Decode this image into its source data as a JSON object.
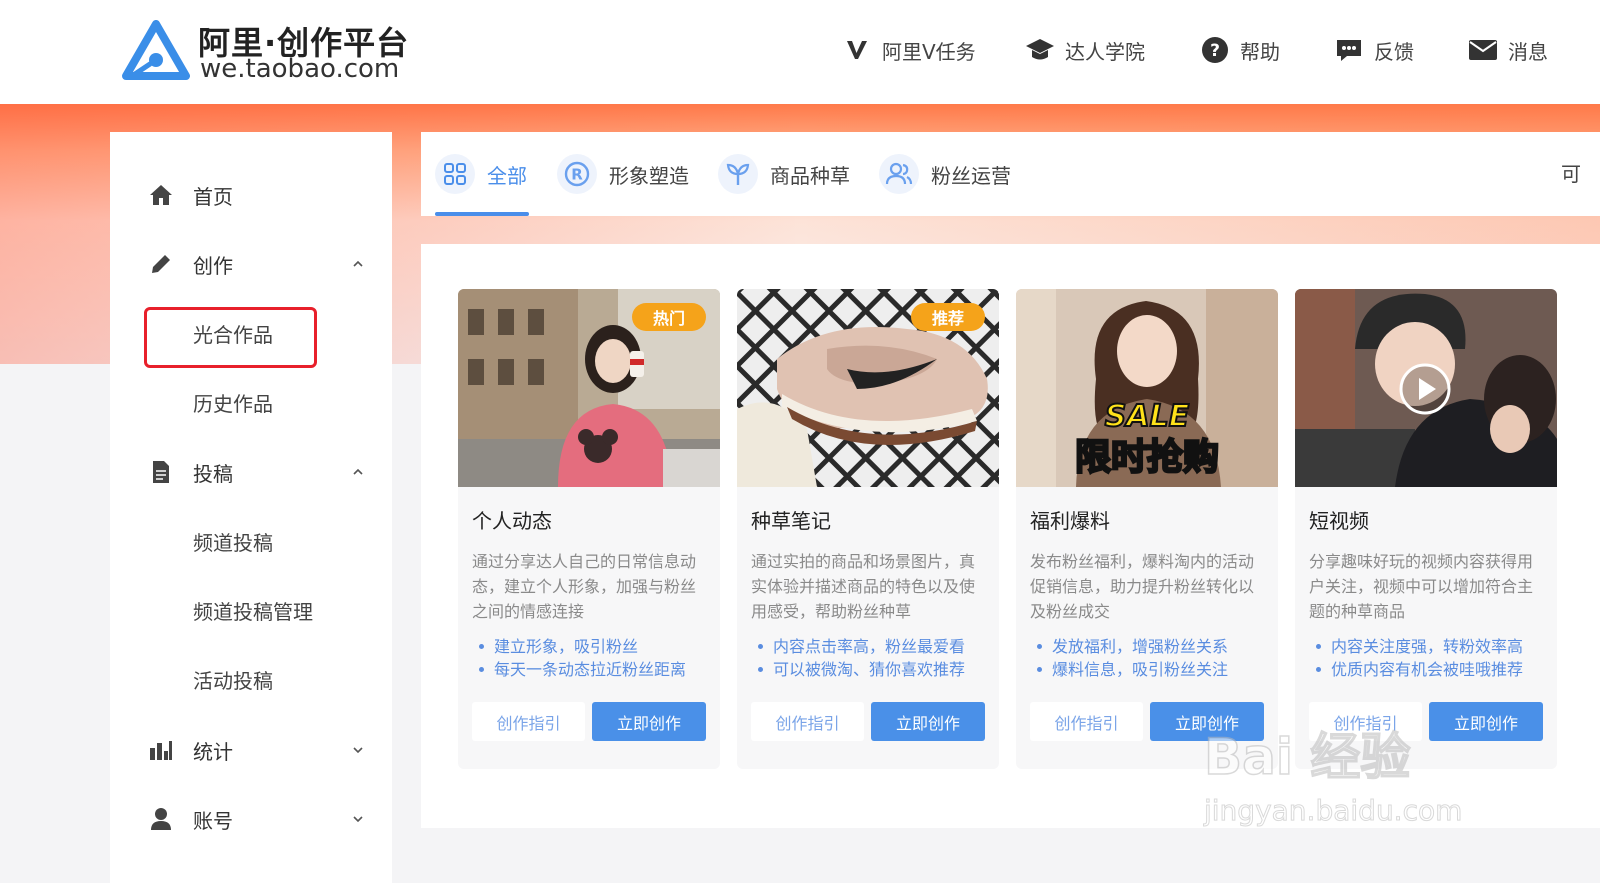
{
  "header": {
    "logo_title": "阿里·创作平台",
    "logo_subtitle": "we.taobao.com",
    "nav": [
      {
        "label": "阿里V任务",
        "icon": "v-task-icon"
      },
      {
        "label": "达人学院",
        "icon": "graduation-cap-icon"
      },
      {
        "label": "帮助",
        "icon": "help-circle-icon"
      },
      {
        "label": "反馈",
        "icon": "chat-bubble-icon"
      },
      {
        "label": "消息",
        "icon": "mail-icon"
      }
    ]
  },
  "sidebar": {
    "items": [
      {
        "label": "首页",
        "icon": "home-icon"
      },
      {
        "label": "创作",
        "icon": "pencil-icon",
        "expanded": true
      },
      {
        "label": "光合作品",
        "highlighted": true
      },
      {
        "label": "历史作品"
      },
      {
        "label": "投稿",
        "icon": "document-icon",
        "expanded": true
      },
      {
        "label": "频道投稿"
      },
      {
        "label": "频道投稿管理"
      },
      {
        "label": "活动投稿"
      },
      {
        "label": "统计",
        "icon": "bar-chart-icon",
        "expanded": false
      },
      {
        "label": "账号",
        "icon": "user-icon",
        "expanded": false
      }
    ]
  },
  "tabs": [
    {
      "label": "全部",
      "icon": "grid-icon",
      "active": true
    },
    {
      "label": "形象塑造",
      "icon": "registered-icon"
    },
    {
      "label": "商品种草",
      "icon": "sprout-icon"
    },
    {
      "label": "粉丝运营",
      "icon": "users-icon"
    }
  ],
  "tab_overflow_text": "可",
  "cards": [
    {
      "title": "个人动态",
      "badge": "热门",
      "description": "通过分享达人自己的日常信息动态，建立个人形象，加强与粉丝之间的情感连接",
      "points": [
        "建立形象，吸引粉丝",
        "每天一条动态拉近粉丝距离"
      ],
      "guide_label": "创作指引",
      "create_label": "立即创作"
    },
    {
      "title": "种草笔记",
      "badge": "推荐",
      "description": "通过实拍的商品和场景图片，真实体验并描述商品的特色以及使用感受，帮助粉丝种草",
      "points": [
        "内容点击率高，粉丝最爱看",
        "可以被微淘、猜你喜欢推荐"
      ],
      "guide_label": "创作指引",
      "create_label": "立即创作"
    },
    {
      "title": "福利爆料",
      "image_text_top": "SALE",
      "image_text_bottom": "限时抢购",
      "description": "发布粉丝福利，爆料淘内的活动促销信息，助力提升粉丝转化以及粉丝成交",
      "points": [
        "发放福利，增强粉丝关系",
        "爆料信息，吸引粉丝关注"
      ],
      "guide_label": "创作指引",
      "create_label": "立即创作"
    },
    {
      "title": "短视频",
      "description": "分享趣味好玩的视频内容获得用户关注，视频中可以增加符合主题的种草商品",
      "points": [
        "内容关注度强，转粉效率高",
        "优质内容有机会被哇哦推荐"
      ],
      "guide_label": "创作指引",
      "create_label": "立即创作"
    }
  ],
  "watermark": {
    "text_top": "Bai 经验",
    "text_bottom": "jingyan.baidu.com"
  },
  "colors": {
    "accent": "#4a90e8",
    "badge": "#f5a31a",
    "highlight": "#e8202b"
  }
}
